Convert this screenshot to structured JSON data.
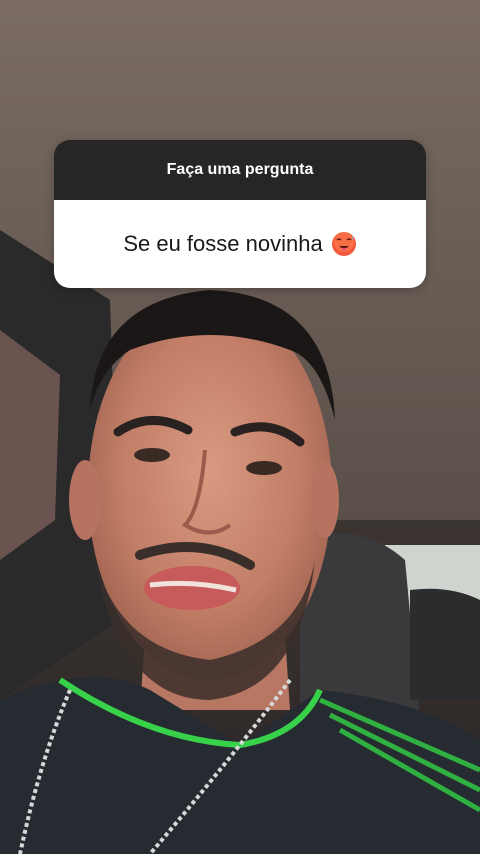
{
  "question_sticker": {
    "header": "Faça uma pergunta",
    "answer": "Se eu fosse novinha",
    "emoji": "hot-face-emoji",
    "header_color": "#262626",
    "body_color": "#ffffff"
  }
}
